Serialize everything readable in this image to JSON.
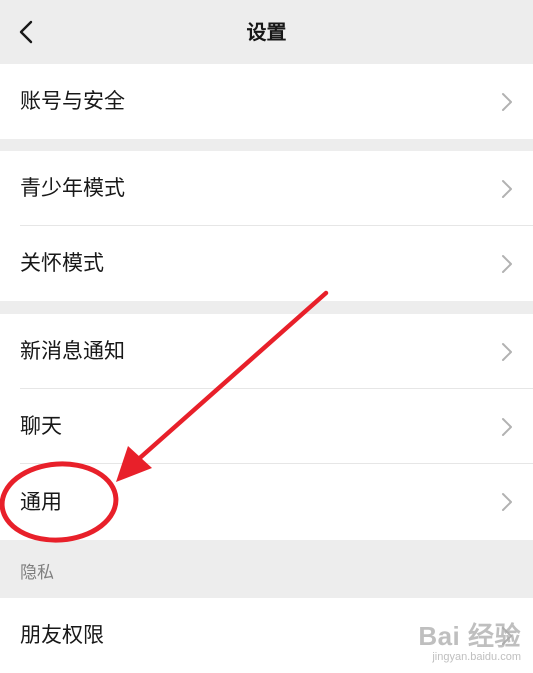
{
  "header": {
    "title": "设置",
    "back_icon": "chevron-left-icon"
  },
  "groups": [
    {
      "items": [
        {
          "label": "账号与安全",
          "icon": "chevron-right-icon"
        }
      ]
    },
    {
      "items": [
        {
          "label": "青少年模式",
          "icon": "chevron-right-icon"
        },
        {
          "label": "关怀模式",
          "icon": "chevron-right-icon"
        }
      ]
    },
    {
      "items": [
        {
          "label": "新消息通知",
          "icon": "chevron-right-icon"
        },
        {
          "label": "聊天",
          "icon": "chevron-right-icon"
        },
        {
          "label": "通用",
          "icon": "chevron-right-icon"
        }
      ]
    }
  ],
  "privacy": {
    "section_title": "隐私",
    "items": [
      {
        "label": "朋友权限",
        "icon": "chevron-right-icon"
      }
    ]
  },
  "annotation": {
    "color": "#e8202a",
    "highlighted_item": "通用"
  },
  "watermark": {
    "brand": "Bai 经验",
    "site": "jingyan.baidu.com"
  },
  "colors": {
    "background": "#ededed",
    "card": "#ffffff",
    "text": "#181818",
    "secondary_text": "#7f7f7f",
    "chevron": "#b2b2b2"
  }
}
